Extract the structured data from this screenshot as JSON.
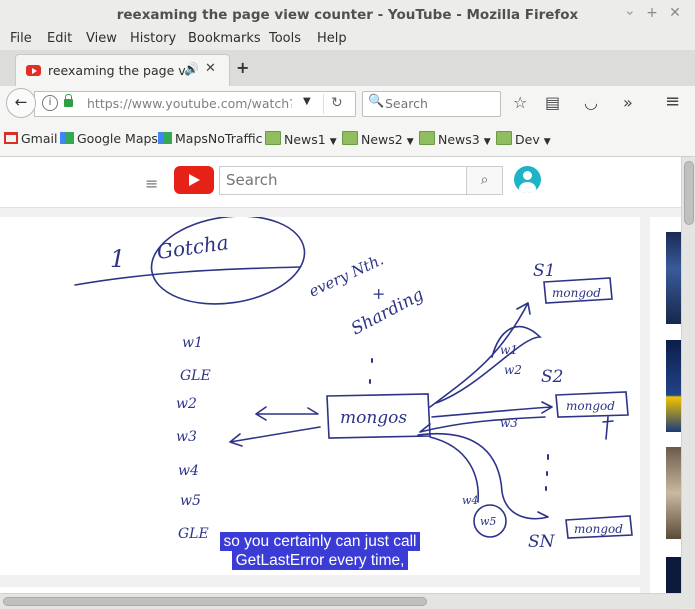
{
  "window": {
    "title": "reexaming the page view counter - YouTube - Mozilla Firefox",
    "minimize": "‹",
    "maximize": "+",
    "close": "✕"
  },
  "menu": {
    "file": "File",
    "edit": "Edit",
    "view": "View",
    "history": "History",
    "bookmarks": "Bookmarks",
    "tools": "Tools",
    "help": "Help"
  },
  "tab": {
    "title": "reexaming the page v…",
    "audio_icon": "speaker-icon",
    "close": "✕",
    "new_tab": "+"
  },
  "navbar": {
    "url": "https://www.youtube.com/watch?v=Mj",
    "search_placeholder": "Search",
    "back_glyph": "←",
    "reload_glyph": "↻",
    "overflow_glyph": "»",
    "menu_glyph": "≡"
  },
  "bookmarks": [
    {
      "label": "Gmail",
      "icon": "gmail-icon"
    },
    {
      "label": "Google Maps",
      "icon": "maps-icon"
    },
    {
      "label": "MapsNoTraffic",
      "icon": "maps-icon"
    },
    {
      "label": "News1",
      "icon": "folder-icon"
    },
    {
      "label": "News2",
      "icon": "folder-icon"
    },
    {
      "label": "News3",
      "icon": "folder-icon"
    },
    {
      "label": "Dev",
      "icon": "folder-icon"
    }
  ],
  "youtube": {
    "search_placeholder": "Search",
    "search_glyph": "⌕",
    "hamburger_glyph": "≡"
  },
  "whiteboard": {
    "heading_number": "1",
    "heading": "Gotcha",
    "note_every": "every Nth.",
    "note_plus": "+",
    "note_sharding": "Sharding",
    "left_labels": [
      "w1",
      "GLE",
      "w2",
      "w3",
      "w4",
      "w5",
      "GLE"
    ],
    "node_center": "mongos",
    "s1": "S1",
    "s1_box": "mongod",
    "s2": "S2",
    "s2_box": "mongod",
    "sn": "SN",
    "sn_box": "mongod",
    "w1_arrow": "w1",
    "w2_arrow": "w2",
    "w3_arrow": "w3",
    "w4_arrow": "w4",
    "w5_arrow": "w5"
  },
  "caption": {
    "line1": "so you certainly can just call",
    "line2": "GetLastError every time,"
  },
  "colors": {
    "ink": "#2d3487",
    "caption_bg": "#3b3bd6",
    "youtube_red": "#e62117"
  }
}
